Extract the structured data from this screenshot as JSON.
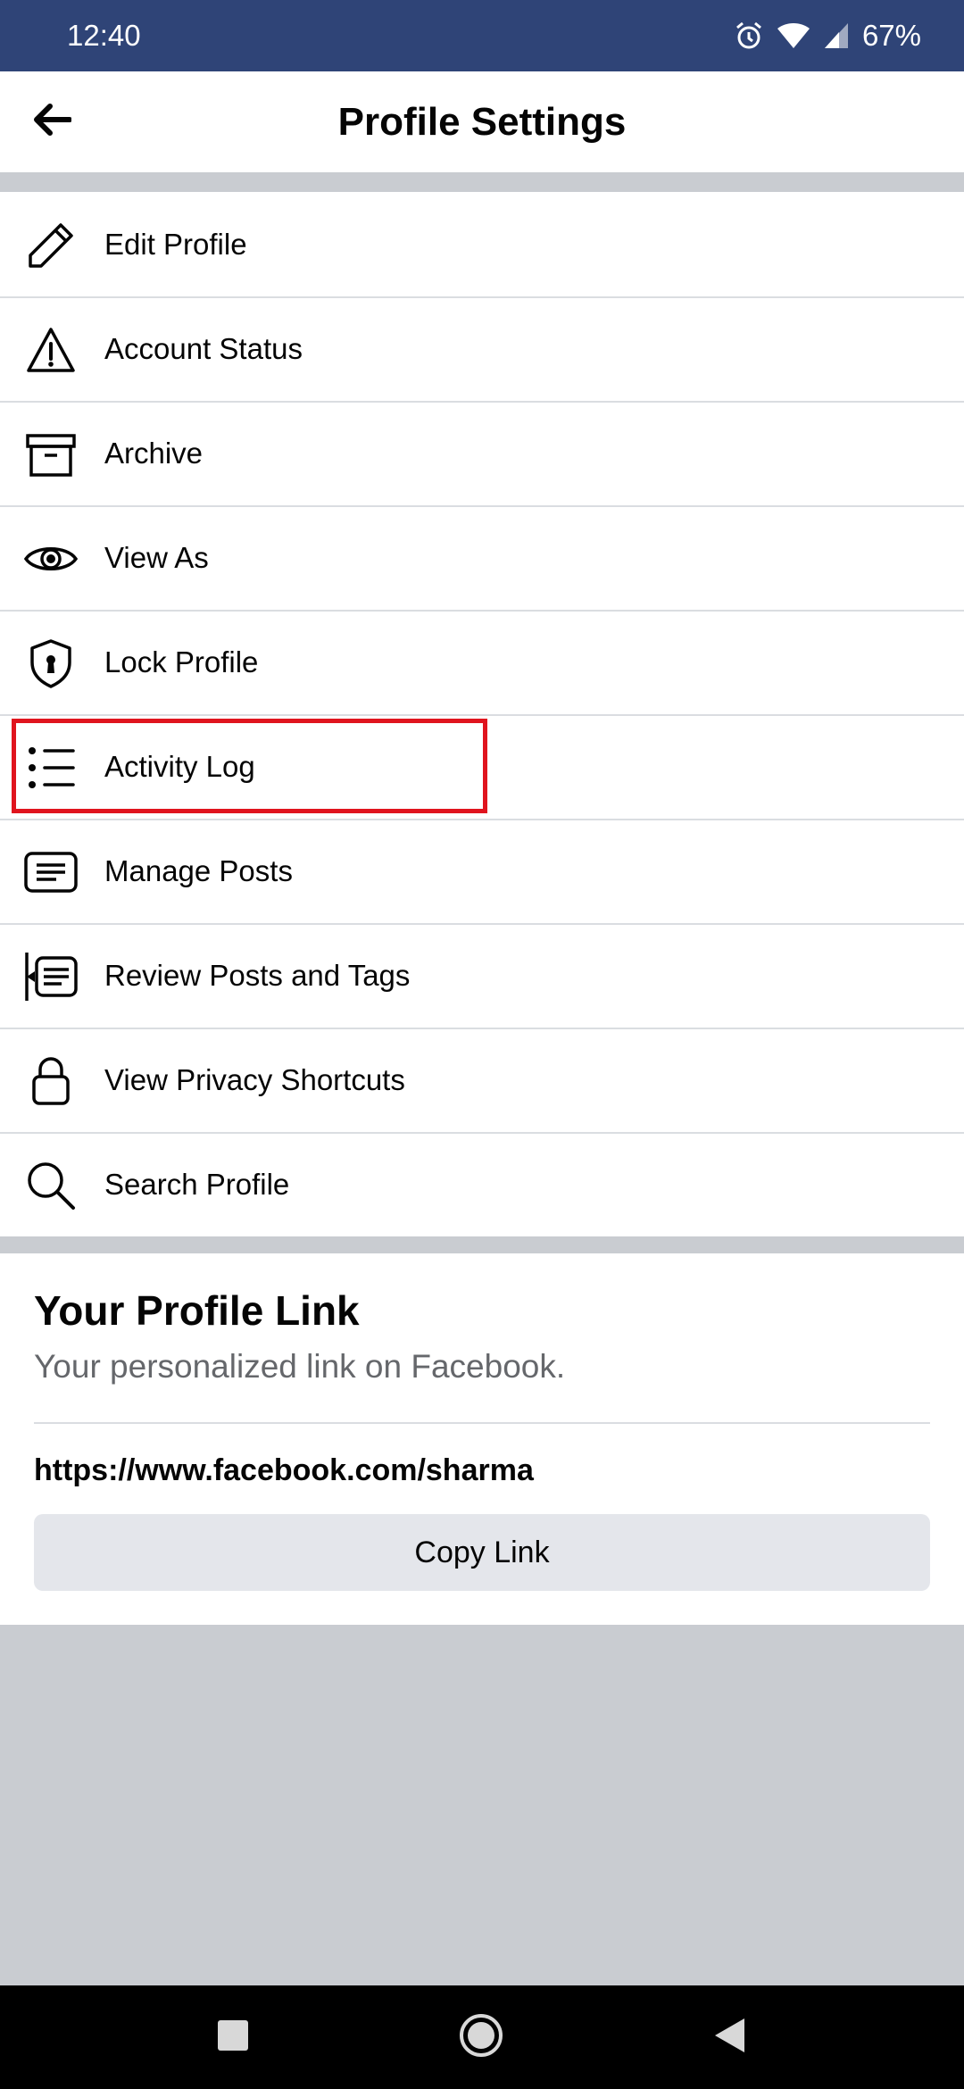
{
  "status_bar": {
    "time": "12:40",
    "battery": "67%",
    "icons": [
      "alarm-icon",
      "wifi-icon",
      "cell-signal-icon",
      "battery-text"
    ]
  },
  "header": {
    "title": "Profile Settings",
    "back_icon": "arrow-left-icon"
  },
  "menu": {
    "items": [
      {
        "label": "Edit Profile",
        "icon": "pencil-icon"
      },
      {
        "label": "Account Status",
        "icon": "warning-icon"
      },
      {
        "label": "Archive",
        "icon": "archive-box-icon"
      },
      {
        "label": "View As",
        "icon": "eye-icon"
      },
      {
        "label": "Lock Profile",
        "icon": "shield-lock-icon"
      },
      {
        "label": "Activity Log",
        "icon": "list-icon",
        "highlighted": true
      },
      {
        "label": "Manage Posts",
        "icon": "posts-icon"
      },
      {
        "label": "Review Posts and Tags",
        "icon": "review-posts-icon"
      },
      {
        "label": "View Privacy Shortcuts",
        "icon": "lock-icon"
      },
      {
        "label": "Search Profile",
        "icon": "search-icon"
      }
    ]
  },
  "profile_link": {
    "title": "Your Profile Link",
    "subtitle": "Your personalized link on Facebook.",
    "url": "https://www.facebook.com/sharma",
    "copy_label": "Copy Link"
  },
  "nav_bar": {
    "buttons": [
      "recents-square-icon",
      "home-circle-icon",
      "back-triangle-icon"
    ]
  },
  "colors": {
    "status_bar_bg": "#2f4477",
    "highlight": "#e0141e",
    "page_bg": "#c9ccd1",
    "button_bg": "#e4e6eb"
  }
}
